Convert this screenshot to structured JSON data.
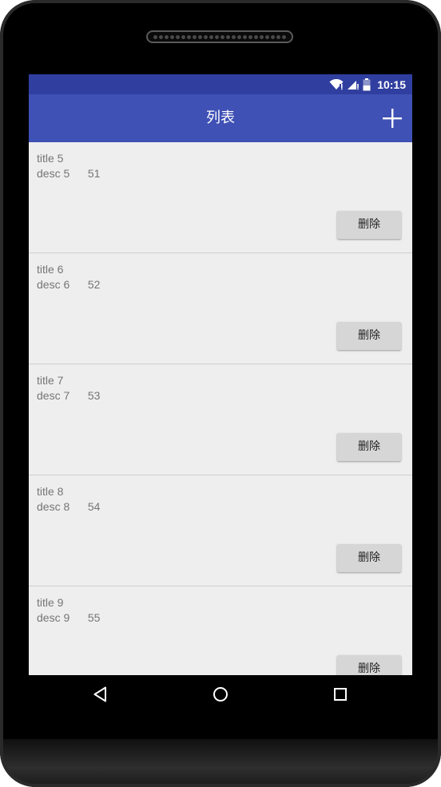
{
  "status_bar": {
    "time": "10:15",
    "icons": [
      "wifi-icon",
      "signal-icon",
      "battery-icon"
    ]
  },
  "app_bar": {
    "title": "列表",
    "action_icon": "plus-icon"
  },
  "items": [
    {
      "title": "title 5",
      "desc": "desc 5",
      "num": "51",
      "button": "删除"
    },
    {
      "title": "title 6",
      "desc": "desc 6",
      "num": "52",
      "button": "删除"
    },
    {
      "title": "title 7",
      "desc": "desc 7",
      "num": "53",
      "button": "删除"
    },
    {
      "title": "title 8",
      "desc": "desc 8",
      "num": "54",
      "button": "删除"
    },
    {
      "title": "title 9",
      "desc": "desc 9",
      "num": "55",
      "button": "删除"
    }
  ],
  "nav_bar": {
    "icons": [
      "back-icon",
      "home-icon",
      "recents-icon"
    ]
  },
  "colors": {
    "status_bar": "#303f9f",
    "app_bar": "#3f51b5",
    "list_background": "#eeeeee",
    "button": "#d6d6d6"
  }
}
